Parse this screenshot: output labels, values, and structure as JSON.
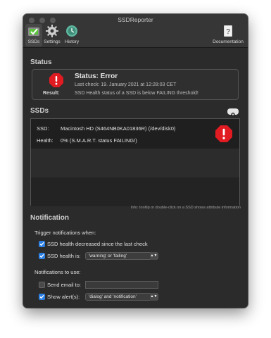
{
  "window": {
    "title": "SSDReporter"
  },
  "toolbar": {
    "items": [
      {
        "label": "SSDs",
        "icon": "ssd-checkmark-icon"
      },
      {
        "label": "Settings",
        "icon": "gear-icon"
      },
      {
        "label": "History",
        "icon": "history-clock-icon"
      },
      {
        "label": "Documentation",
        "icon": "help-book-icon"
      }
    ]
  },
  "status": {
    "section_title": "Status",
    "title": "Status: Error",
    "last_check": "Last check: 19. January 2021 at 12:28:03 CET",
    "result_label": "Result:",
    "result_value": "SSD Health status of a SSD is below FAILING threshold!"
  },
  "ssds": {
    "section_title": "SSDs",
    "rows": [
      {
        "ssd_label": "SSD:",
        "ssd_value": "Macintosh HD (S464NB0KA01836R)  (/dev/disk0)",
        "health_label": "Health:",
        "health_value": "0% (S.M.A.R.T. status FAILING!)"
      }
    ],
    "info": "Info: tooltip or double-click on a SSD shows attribute information"
  },
  "notification": {
    "section_title": "Notification",
    "trigger_heading": "Trigger notifications when:",
    "health_decreased": {
      "label": "SSD health decreased since the last check",
      "checked": true
    },
    "health_is": {
      "label": "SSD health is:",
      "checked": true,
      "selected": "'warning' or 'failing'"
    },
    "use_heading": "Notifications to use:",
    "send_email": {
      "label": "Send email to:",
      "checked": false,
      "value": ""
    },
    "show_alerts": {
      "label": "Show alert(s):",
      "checked": true,
      "selected": "'dialog' and 'notification'"
    }
  },
  "colors": {
    "accent": "#2c7fe2",
    "error": "#e11b22"
  }
}
